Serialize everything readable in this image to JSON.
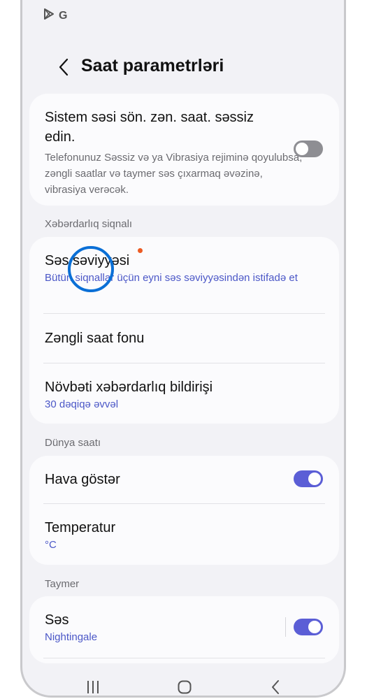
{
  "status_bar": {
    "g_label": "G"
  },
  "header": {
    "title": "Saat parametrləri"
  },
  "system_sound": {
    "title": "Sistem səsi sön. zən. saat. səssiz edin.",
    "description": "Telefonunuz Səssiz və ya Vibrasiya rejiminə qoyulubsa, zəngli saatlar və taymer səs çıxarmaq əvəzinə, vibrasiya verəcək.",
    "toggle_on": false
  },
  "alarm_section": {
    "header": "Xəbərdarlıq siqnalı",
    "items": [
      {
        "title": "Səs səviyyəsi",
        "subtitle": "Bütün siqnallar üçün eyni səs səviyyəsindən istifadə et"
      },
      {
        "title": "Zəngli saat fonu"
      },
      {
        "title": "Növbəti xəbərdarlıq bildirişi",
        "subtitle": "30 dəqiqə əvvəl"
      }
    ]
  },
  "world_clock_section": {
    "header": "Dünya saatı",
    "items": [
      {
        "title": "Hava göstər",
        "toggle_on": true
      },
      {
        "title": "Temperatur",
        "subtitle": "°C"
      }
    ]
  },
  "timer_section": {
    "header": "Taymer",
    "items": [
      {
        "title": "Səs",
        "subtitle": "Nightingale",
        "toggle_on": true
      }
    ]
  },
  "colors": {
    "accent": "#5b5ed6",
    "link": "#4b57c7",
    "badge": "#ec5b23",
    "touch_indicator": "#0a6fd6"
  }
}
